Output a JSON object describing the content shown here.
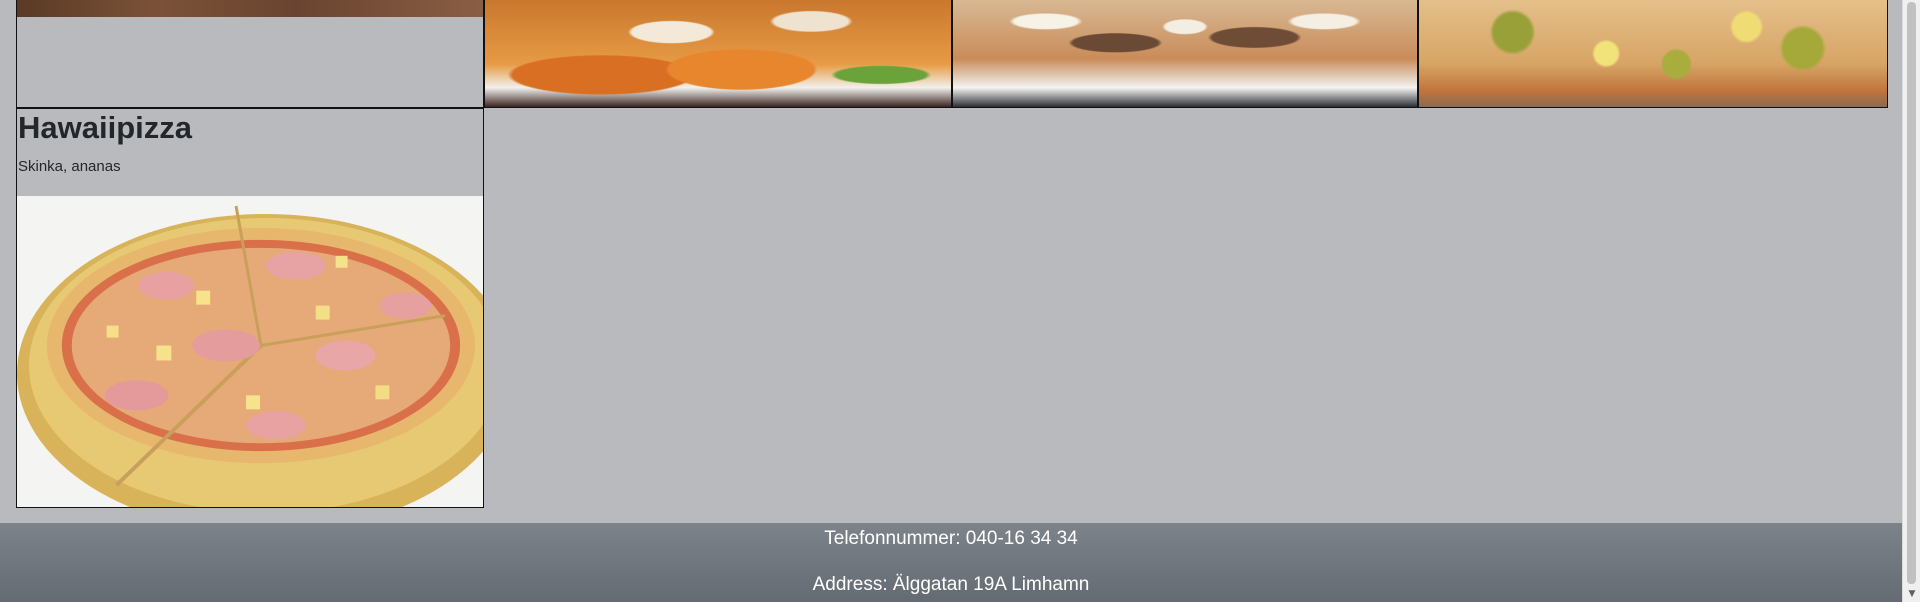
{
  "menu": {
    "items": [
      {
        "title": "Hawaiipizza",
        "description": "Skinka, ananas"
      }
    ]
  },
  "footer": {
    "phone": "Telefonnummer: 040-16 34 34",
    "address": "Address: Älggatan 19A Limhamn"
  },
  "icons": {
    "scroll_down": "▼"
  },
  "colors": {
    "page_background": "#b8babe",
    "footer_background": "#6f757c",
    "text": "#23272b",
    "footer_text": "#ffffff"
  }
}
